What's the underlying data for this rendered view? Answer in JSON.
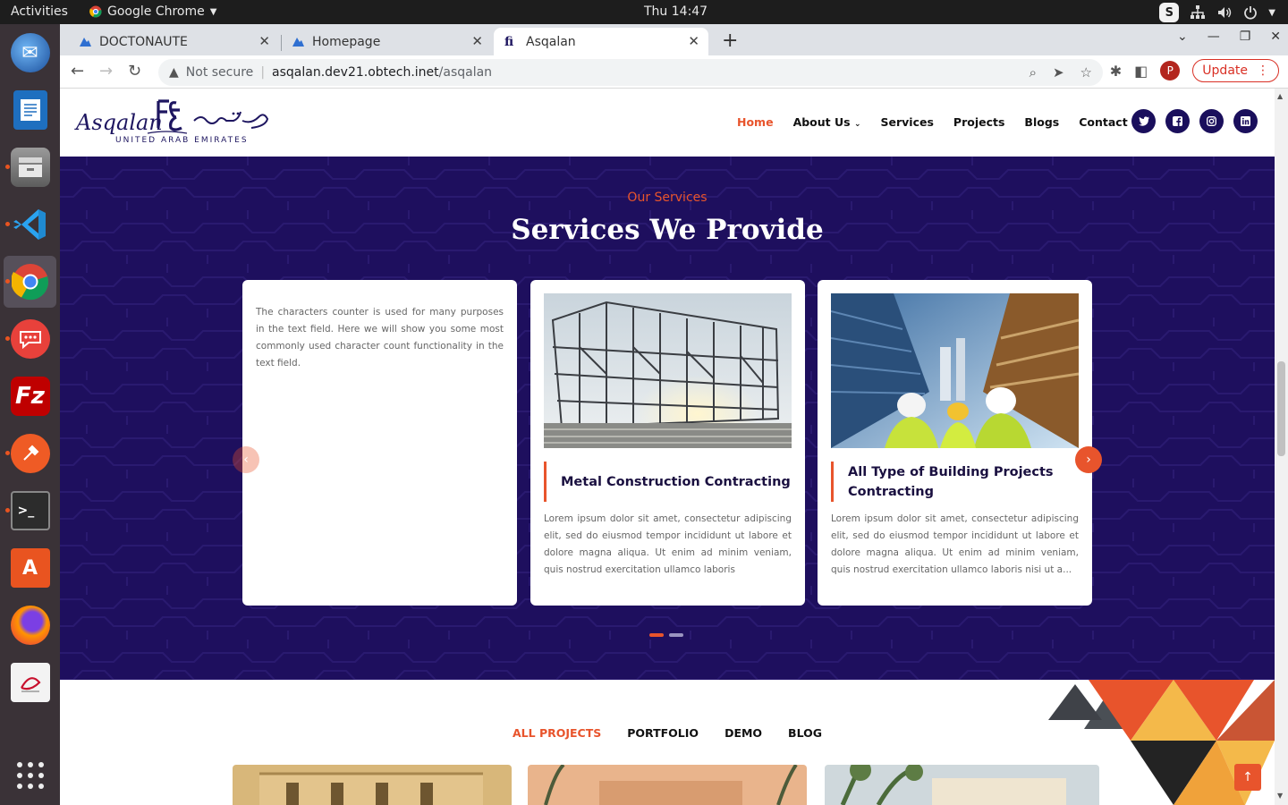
{
  "system": {
    "activities": "Activities",
    "app_name": "Google Chrome",
    "clock": "Thu 14:47",
    "s_badge": "S"
  },
  "dock": {
    "items": [
      "thunderbird-icon",
      "libreoffice-writer-icon",
      "files-icon",
      "vscode-icon",
      "chrome-icon",
      "chat-icon",
      "filezilla-icon",
      "postman-icon",
      "terminal-icon",
      "software-center-icon",
      "firefox-icon",
      "pdf-editor-icon",
      "show-apps-icon"
    ]
  },
  "browser": {
    "tabs": [
      {
        "label": "DOCTONAUTE"
      },
      {
        "label": "Homepage"
      },
      {
        "label": "Asqalan"
      }
    ],
    "address": {
      "security": "Not secure",
      "host": "asqalan.dev21.obtech.inet",
      "path": "/asqalan"
    },
    "profile_initial": "P",
    "update_label": "Update"
  },
  "site": {
    "logo": {
      "name": "Asqalan",
      "subtitle": "UNITED ARAB EMIRATES"
    },
    "nav": {
      "home": "Home",
      "about": "About Us",
      "services": "Services",
      "projects": "Projects",
      "blogs": "Blogs",
      "contact": "Contact Us"
    },
    "socials": [
      "twitter-icon",
      "facebook-icon",
      "instagram-icon",
      "linkedin-icon"
    ],
    "services_section": {
      "kicker": "Our Services",
      "title": "Services We Provide",
      "cards": [
        {
          "text": "The characters counter is used for many purposes in the text field. Here we will show you some most commonly used character count functionality in the text field."
        },
        {
          "title": "Metal Construction Contracting",
          "text": "Lorem ipsum dolor sit amet, consectetur adipiscing elit, sed do eiusmod tempor incididunt ut labore et dolore magna aliqua. Ut enim ad minim veniam, quis nostrud exercitation ullamco laboris"
        },
        {
          "title": "All Type of Building Projects Contracting",
          "text": "Lorem ipsum dolor sit amet, consectetur adipiscing elit, sed do eiusmod tempor incididunt ut labore et dolore magna aliqua. Ut enim ad minim veniam, quis nostrud exercitation ullamco laboris nisi ut a..."
        }
      ],
      "slides": 2,
      "active_slide": 1
    },
    "project_tabs": {
      "all": "ALL PROJECTS",
      "portfolio": "PORTFOLIO",
      "demo": "DEMO",
      "blog": "BLOG"
    }
  },
  "colors": {
    "accent": "#e8542c",
    "navy": "#1e0f5e"
  }
}
